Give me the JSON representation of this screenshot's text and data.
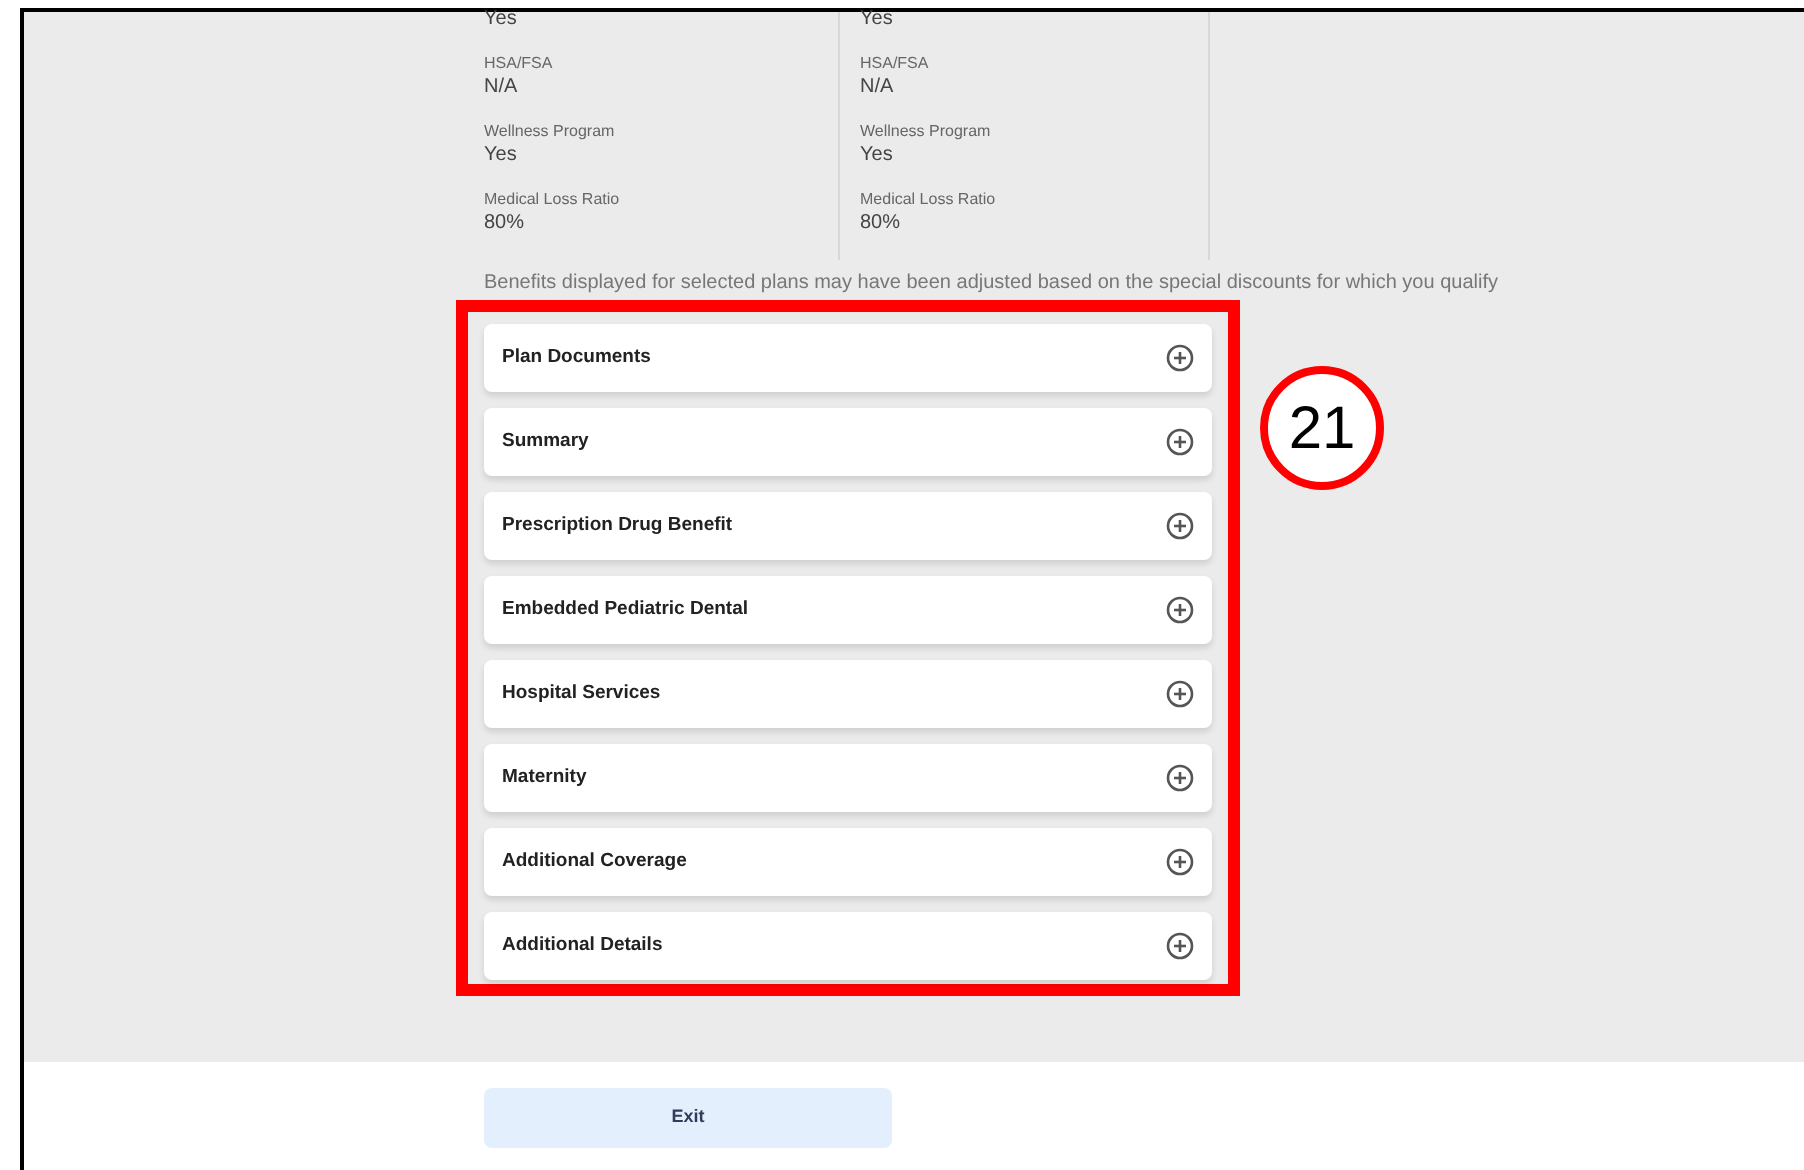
{
  "plans": [
    {
      "fields": [
        {
          "value": "Yes"
        },
        {
          "label": "HSA/FSA",
          "value": "N/A"
        },
        {
          "label": "Wellness Program",
          "value": "Yes"
        },
        {
          "label": "Medical Loss Ratio",
          "value": "80%"
        }
      ]
    },
    {
      "fields": [
        {
          "value": "Yes"
        },
        {
          "label": "HSA/FSA",
          "value": "N/A"
        },
        {
          "label": "Wellness Program",
          "value": "Yes"
        },
        {
          "label": "Medical Loss Ratio",
          "value": "80%"
        }
      ]
    }
  ],
  "disclaimer": "Benefits displayed for selected plans may have been adjusted based on the special discounts for which you qualify",
  "sections": [
    {
      "title": "Plan Documents",
      "expanded": false
    },
    {
      "title": "Summary",
      "expanded": false
    },
    {
      "title": "Prescription Drug Benefit",
      "expanded": false
    },
    {
      "title": "Embedded Pediatric Dental",
      "expanded": false
    },
    {
      "title": "Hospital Services",
      "expanded": false
    },
    {
      "title": "Maternity",
      "expanded": false
    },
    {
      "title": "Additional Coverage",
      "expanded": false
    },
    {
      "title": "Additional Details",
      "expanded": false
    }
  ],
  "annotation": {
    "number": "21"
  },
  "exit_button": "Exit"
}
